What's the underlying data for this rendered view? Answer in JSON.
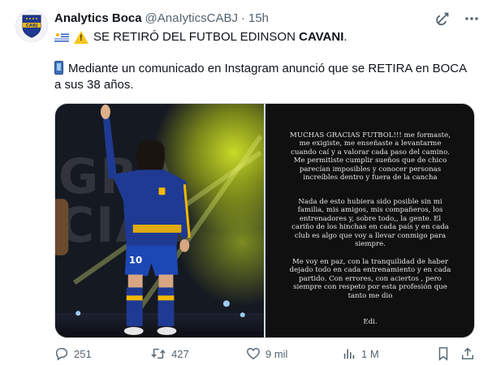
{
  "author": {
    "name": "Analytics Boca",
    "handle": "@AnaIyticsCABJ",
    "separator": "·",
    "time": "15h"
  },
  "top_icons": [
    "grok-icon",
    "more-icon"
  ],
  "tweet": {
    "line1_prefix": "SE RETIRÓ DEL FUTBOL EDINSON",
    "line1_bold": "CAVANI",
    "line1_suffix": ".",
    "line2": "Mediante un comunicado en Instagram anunció que se RETIRA en BOCA a sus 38 años."
  },
  "photo": {
    "jersey_number": "10"
  },
  "letter": {
    "p1": "MUCHAS GRACIAS FUTBOL!!! me formaste, me exigiste, me enseñaste a levantarme cuando caí y a valorar cada paso del camino. Me permitiste cumplir sueños que de chico parecían imposibles y conocer personas increíbles dentro y fuera de la cancha",
    "p2": "Nada de esto hubiera sido posible sin mi familia, mis amigos, mis compañeros, los entrenadores y, sobre todo,, la gente. El cariño de los hinchas en cada país y en cada club es algo que voy a llevar conmigo para siempre.",
    "p3": "Me voy en paz, con la tranquilidad de haber dejado todo en cada entrenamiento y en cada partido. Con errores, con aciertos , pero siempre con respeto por esta profesión que tanto me dio",
    "p4": "Edi."
  },
  "actions": {
    "replies": "251",
    "reposts": "427",
    "likes": "9 mil",
    "views": "1 M"
  },
  "colors": {
    "text": "#0f1419",
    "secondary": "#536471",
    "border": "#cfd9de",
    "boca_blue": "#1f3a93",
    "boca_gold": "#f5b800"
  }
}
